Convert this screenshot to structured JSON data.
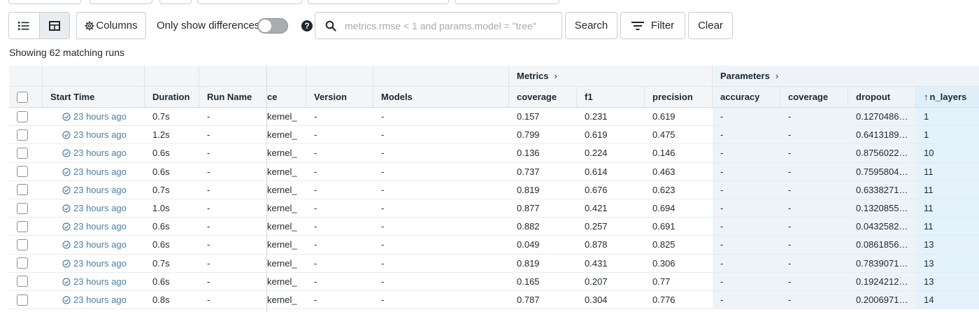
{
  "toolbar": {
    "columns_label": "Columns",
    "diff_toggle_label": "Only show differences",
    "diff_toggle_on": false,
    "search_placeholder": "metrics.rmse < 1 and params.model = \"tree\"",
    "search_value": "",
    "search_button": "Search",
    "filter_button": "Filter",
    "clear_button": "Clear"
  },
  "summary": "Showing 62 matching runs",
  "groups": {
    "metrics": "Metrics",
    "parameters": "Parameters"
  },
  "columns": {
    "start_time": "Start Time",
    "duration": "Duration",
    "run_name": "Run Name",
    "source": "ce",
    "version": "Version",
    "models": "Models",
    "coverage": "coverage",
    "f1": "f1",
    "precision": "precision",
    "p_accuracy": "accuracy",
    "p_coverage": "coverage",
    "p_dropout": "dropout",
    "p_nlayers": "n_layers"
  },
  "sort_indicator": "↑",
  "rows": [
    {
      "time": "23 hours ago",
      "duration": "0.7s",
      "run_name": "-",
      "source": "kernel_",
      "version": "-",
      "models": "-",
      "coverage": "0.157",
      "f1": "0.231",
      "precision": "0.619",
      "p_accuracy": "-",
      "p_coverage": "-",
      "p_dropout": "0.1270486…",
      "p_nlayers": "1"
    },
    {
      "time": "23 hours ago",
      "duration": "1.2s",
      "run_name": "-",
      "source": "kernel_",
      "version": "-",
      "models": "-",
      "coverage": "0.799",
      "f1": "0.619",
      "precision": "0.475",
      "p_accuracy": "-",
      "p_coverage": "-",
      "p_dropout": "0.6413189…",
      "p_nlayers": "1"
    },
    {
      "time": "23 hours ago",
      "duration": "0.6s",
      "run_name": "-",
      "source": "kernel_",
      "version": "-",
      "models": "-",
      "coverage": "0.136",
      "f1": "0.224",
      "precision": "0.146",
      "p_accuracy": "-",
      "p_coverage": "-",
      "p_dropout": "0.8756022…",
      "p_nlayers": "10"
    },
    {
      "time": "23 hours ago",
      "duration": "0.6s",
      "run_name": "-",
      "source": "kernel_",
      "version": "-",
      "models": "-",
      "coverage": "0.737",
      "f1": "0.614",
      "precision": "0.463",
      "p_accuracy": "-",
      "p_coverage": "-",
      "p_dropout": "0.7595804…",
      "p_nlayers": "11"
    },
    {
      "time": "23 hours ago",
      "duration": "0.7s",
      "run_name": "-",
      "source": "kernel_",
      "version": "-",
      "models": "-",
      "coverage": "0.819",
      "f1": "0.676",
      "precision": "0.623",
      "p_accuracy": "-",
      "p_coverage": "-",
      "p_dropout": "0.6338271…",
      "p_nlayers": "11"
    },
    {
      "time": "23 hours ago",
      "duration": "1.0s",
      "run_name": "-",
      "source": "kernel_",
      "version": "-",
      "models": "-",
      "coverage": "0.877",
      "f1": "0.421",
      "precision": "0.694",
      "p_accuracy": "-",
      "p_coverage": "-",
      "p_dropout": "0.1320855…",
      "p_nlayers": "11"
    },
    {
      "time": "23 hours ago",
      "duration": "0.6s",
      "run_name": "-",
      "source": "kernel_",
      "version": "-",
      "models": "-",
      "coverage": "0.882",
      "f1": "0.257",
      "precision": "0.691",
      "p_accuracy": "-",
      "p_coverage": "-",
      "p_dropout": "0.0432582…",
      "p_nlayers": "11"
    },
    {
      "time": "23 hours ago",
      "duration": "0.6s",
      "run_name": "-",
      "source": "kernel_",
      "version": "-",
      "models": "-",
      "coverage": "0.049",
      "f1": "0.878",
      "precision": "0.825",
      "p_accuracy": "-",
      "p_coverage": "-",
      "p_dropout": "0.0861856…",
      "p_nlayers": "13"
    },
    {
      "time": "23 hours ago",
      "duration": "0.7s",
      "run_name": "-",
      "source": "kernel_",
      "version": "-",
      "models": "-",
      "coverage": "0.819",
      "f1": "0.431",
      "precision": "0.306",
      "p_accuracy": "-",
      "p_coverage": "-",
      "p_dropout": "0.7839071…",
      "p_nlayers": "13"
    },
    {
      "time": "23 hours ago",
      "duration": "0.6s",
      "run_name": "-",
      "source": "kernel_",
      "version": "-",
      "models": "-",
      "coverage": "0.165",
      "f1": "0.207",
      "precision": "0.77",
      "p_accuracy": "-",
      "p_coverage": "-",
      "p_dropout": "0.1924212…",
      "p_nlayers": "13"
    },
    {
      "time": "23 hours ago",
      "duration": "0.8s",
      "run_name": "-",
      "source": "kernel_",
      "version": "-",
      "models": "-",
      "coverage": "0.787",
      "f1": "0.304",
      "precision": "0.776",
      "p_accuracy": "-",
      "p_coverage": "-",
      "p_dropout": "0.2006971…",
      "p_nlayers": "14"
    }
  ]
}
